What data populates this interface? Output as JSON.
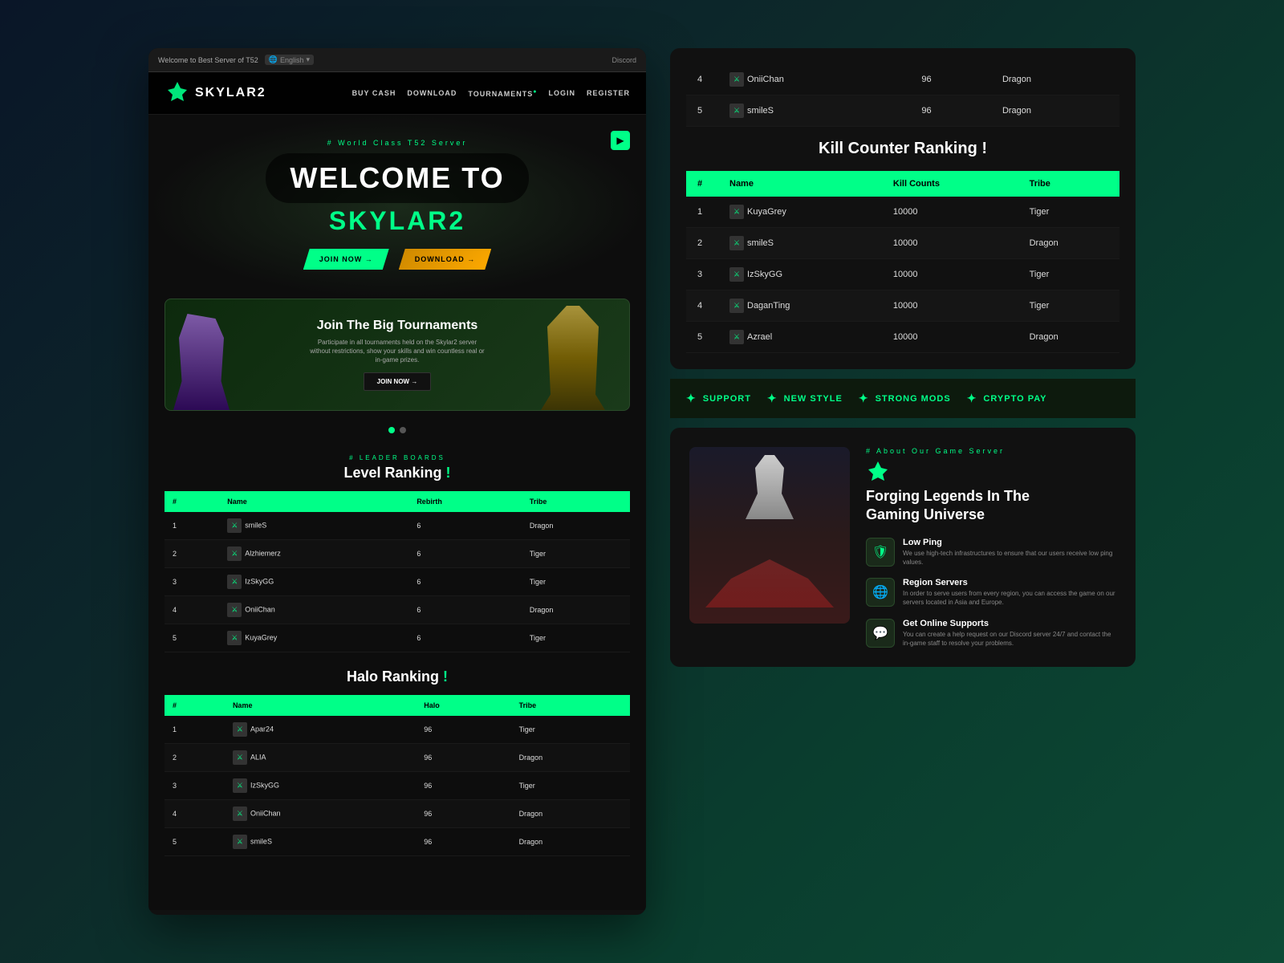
{
  "browser": {
    "tab_text": "Welcome to Best Server of T52",
    "lang": "English",
    "discord": "Discord"
  },
  "nav": {
    "logo": "SKYLAR2",
    "links": [
      "BUY CASH",
      "DOWNLOAD",
      "TOURNAMENTS",
      "LOGIN",
      "REGISTER"
    ]
  },
  "hero": {
    "subtitle": "# World Class T52 Server",
    "welcome": "WELCOME TO",
    "site_name": "SKYLAR2",
    "btn_join": "JOIN NOW →",
    "btn_download": "DOWNLOAD →"
  },
  "tournament": {
    "title": "Join The Big Tournaments",
    "desc": "Participate in all tournaments held on the Skylar2 server without restrictions, show your skills and win countless real or in-game prizes.",
    "btn": "JOIN NOW →",
    "dot1_active": true,
    "dot2_active": false
  },
  "level_ranking": {
    "label": "# LEADER BOARDS",
    "title": "Level Ranking",
    "highlight": "!",
    "headers": [
      "#",
      "Name",
      "Rebirth",
      "Tribe"
    ],
    "rows": [
      {
        "rank": 1,
        "name": "smileS",
        "rebirth": 6,
        "tribe": "Dragon"
      },
      {
        "rank": 2,
        "name": "Alzhiemerz",
        "rebirth": 6,
        "tribe": "Tiger"
      },
      {
        "rank": 3,
        "name": "IzSkyGG",
        "rebirth": 6,
        "tribe": "Tiger"
      },
      {
        "rank": 4,
        "name": "OniiChan",
        "rebirth": 6,
        "tribe": "Dragon"
      },
      {
        "rank": 5,
        "name": "KuyaGrey",
        "rebirth": 6,
        "tribe": "Tiger"
      }
    ]
  },
  "halo_ranking": {
    "title": "Halo Ranking",
    "highlight": "!",
    "headers": [
      "#",
      "Name",
      "Halo",
      "Tribe"
    ],
    "rows": [
      {
        "rank": 1,
        "name": "Apar24",
        "halo": 96,
        "tribe": "Tiger"
      },
      {
        "rank": 2,
        "name": "ALIA",
        "halo": 96,
        "tribe": "Dragon"
      },
      {
        "rank": 3,
        "name": "IzSkyGG",
        "halo": 96,
        "tribe": "Tiger"
      },
      {
        "rank": 4,
        "name": "OniiChan",
        "halo": 96,
        "tribe": "Dragon"
      },
      {
        "rank": 5,
        "name": "smileS",
        "halo": 96,
        "tribe": "Dragon"
      }
    ]
  },
  "right_panel": {
    "prev_halo_rows": [
      {
        "rank": 4,
        "name": "OniiChan",
        "halo": 96,
        "tribe": "Dragon"
      },
      {
        "rank": 5,
        "name": "smileS",
        "halo": 96,
        "tribe": "Dragon"
      }
    ],
    "kill_counter": {
      "title": "Kill Counter Ranking !",
      "headers": [
        "#",
        "Name",
        "Kill Counts",
        "Tribe"
      ],
      "rows": [
        {
          "rank": 1,
          "name": "KuyaGrey",
          "kills": 10000,
          "tribe": "Tiger"
        },
        {
          "rank": 2,
          "name": "smileS",
          "kills": 10000,
          "tribe": "Dragon"
        },
        {
          "rank": 3,
          "name": "IzSkyGG",
          "kills": 10000,
          "tribe": "Tiger"
        },
        {
          "rank": 4,
          "name": "DaganTing",
          "kills": 10000,
          "tribe": "Tiger"
        },
        {
          "rank": 5,
          "name": "Azrael",
          "kills": 10000,
          "tribe": "Dragon"
        }
      ]
    },
    "features": [
      {
        "icon": "✦",
        "label": "SUPPORT"
      },
      {
        "icon": "✦",
        "label": "NEW STYLE"
      },
      {
        "icon": "✦",
        "label": "STRONG MODS"
      },
      {
        "icon": "✦",
        "label": "CRYPTO PAY"
      }
    ],
    "about": {
      "label": "# About Our Game Server",
      "title_line1": "Forging Legends In The",
      "title_line2": "Gaming Universe",
      "features": [
        {
          "icon": "🛡",
          "name": "Low Ping",
          "desc": "We use high-tech infrastructures to ensure that our users receive low ping values."
        },
        {
          "icon": "🌐",
          "name": "Region Servers",
          "desc": "In order to serve users from every region, you can access the game on our servers located in Asia and Europe."
        },
        {
          "icon": "💬",
          "name": "Get Online Supports",
          "desc": "You can create a help request on our Discord server 24/7 and contact the in-game staff to resolve your problems."
        }
      ]
    }
  }
}
